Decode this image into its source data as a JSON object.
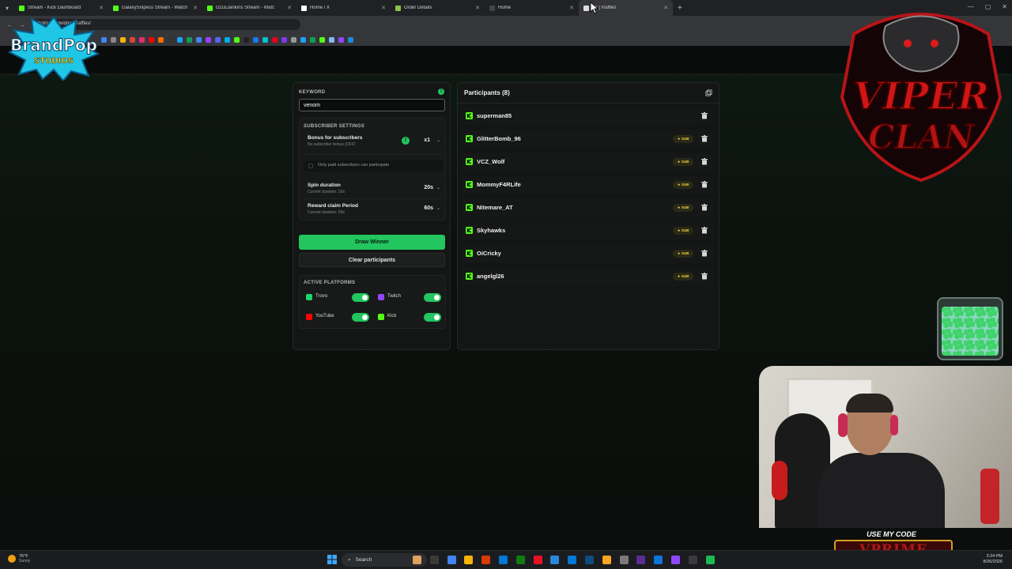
{
  "browser": {
    "tabs": [
      {
        "title": "Stream - Kick Dashboard",
        "color": "#53fc18"
      },
      {
        "title": "GalaxySnipess Stream - Watch",
        "color": "#53fc18"
      },
      {
        "title": "GzusJankins Stream - Watc",
        "color": "#53fc18"
      },
      {
        "title": "Home / X",
        "color": "#ffffff"
      },
      {
        "title": "Order Details",
        "color": "#8bc34a"
      },
      {
        "title": "Home",
        "color": "#444444"
      },
      {
        "title": "Bk | Raffles",
        "color": "#dddddd"
      }
    ],
    "url": "botrix.live/widgets/raffles/"
  },
  "keyword": {
    "label": "KEYWORD",
    "value": "venom"
  },
  "subscriber_settings": {
    "label": "SUBSCRIBER SETTINGS",
    "bonus_title": "Bonus for subscribers",
    "bonus_subtitle": "No subscriber bonus (OFF)",
    "bonus_value": "x1",
    "paid_only": "Only paid subscribers can participate",
    "spin_title": "Spin duration",
    "spin_subtitle": "Current duration: 20s",
    "spin_value": "20s",
    "reward_title": "Reward claim Period",
    "reward_subtitle": "Current duration: 60s",
    "reward_value": "60s"
  },
  "actions": {
    "draw": "Draw Winner",
    "clear": "Clear participants"
  },
  "platforms": {
    "label": "ACTIVE PLATFORMS",
    "items": [
      {
        "name": "Trovo",
        "color": "#19d66b"
      },
      {
        "name": "Twitch",
        "color": "#9146ff"
      },
      {
        "name": "YouTube",
        "color": "#ff0000"
      },
      {
        "name": "Kick",
        "color": "#53fc18"
      }
    ]
  },
  "participants": {
    "title": "Participants (8)",
    "items": [
      {
        "name": "superman85",
        "sub": false
      },
      {
        "name": "GlitterBomb_96",
        "sub": true
      },
      {
        "name": "VCZ_Wolf",
        "sub": true
      },
      {
        "name": "MommyF4RLife",
        "sub": true
      },
      {
        "name": "Nitemare_AT",
        "sub": true
      },
      {
        "name": "Skyhawks",
        "sub": true
      },
      {
        "name": "OiCricky",
        "sub": true
      },
      {
        "name": "angelgl26",
        "sub": true
      }
    ],
    "sub_badge": "★ SUB"
  },
  "overlay": {
    "promo_label": "USE MY CODE",
    "promo_code": "VPRIME"
  },
  "taskbar": {
    "weather_temp": "76°F",
    "weather_cond": "Sunny",
    "search": "Search",
    "time": "3:24 PM",
    "date": "8/26/2026"
  },
  "colors": {
    "accent": "#22c55e",
    "kick": "#53fc18",
    "sub_gold": "#f5d142"
  }
}
